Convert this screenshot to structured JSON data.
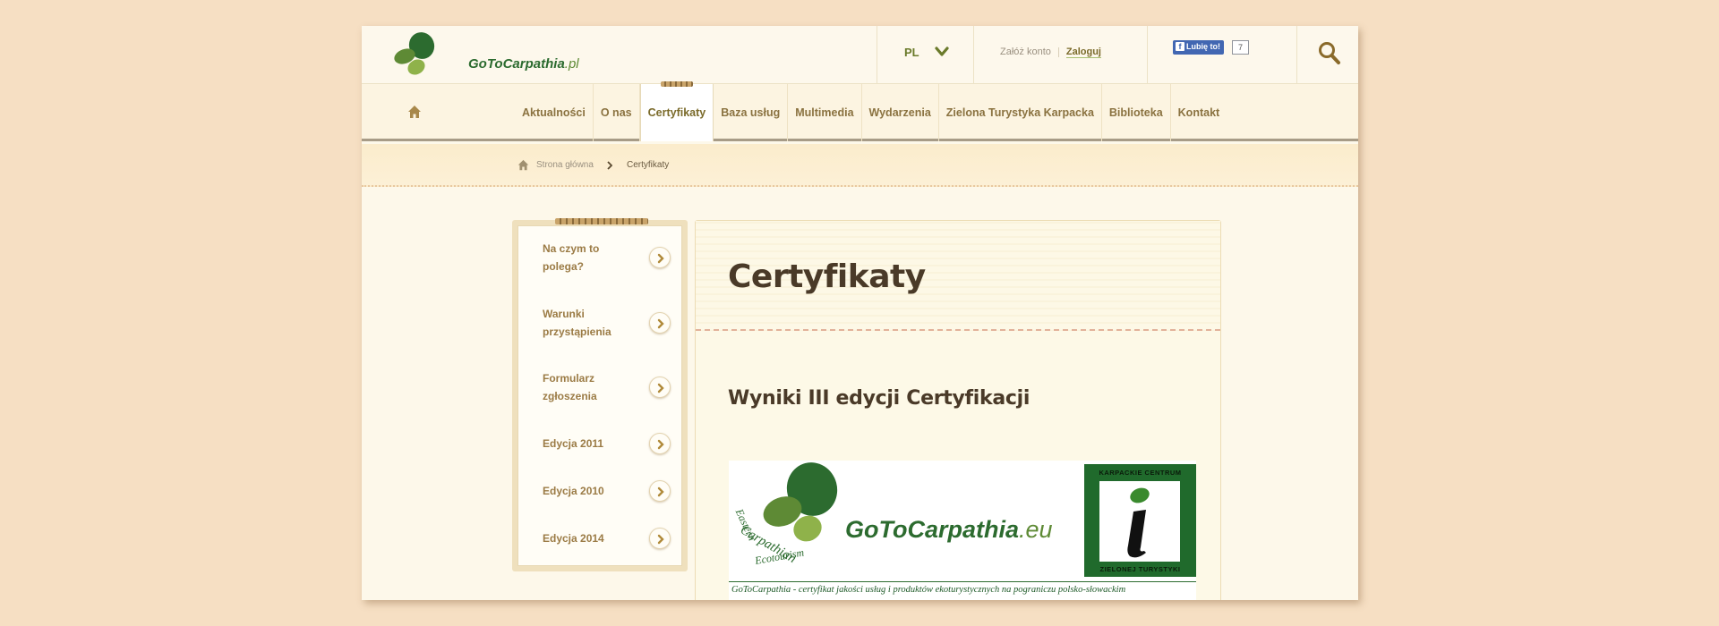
{
  "header": {
    "logo_text_brand": "GoToCarpathia",
    "logo_text_domain": ".pl",
    "language": "PL",
    "register_label": "Załóż konto",
    "login_label": "Zaloguj",
    "fb_like_label": "Lubię to!",
    "fb_count": "7"
  },
  "nav": {
    "items": [
      {
        "label": "Aktualności"
      },
      {
        "label": "O nas"
      },
      {
        "label": "Certyfikaty",
        "active": true
      },
      {
        "label": "Baza usług"
      },
      {
        "label": "Multimedia"
      },
      {
        "label": "Wydarzenia"
      },
      {
        "label": "Zielona Turystyka Karpacka"
      },
      {
        "label": "Biblioteka"
      },
      {
        "label": "Kontakt"
      }
    ]
  },
  "breadcrumb": {
    "home": "Strona główna",
    "current": "Certyfikaty"
  },
  "sidebar": {
    "items": [
      {
        "label": "Na czym to polega?"
      },
      {
        "label": "Warunki przystąpienia"
      },
      {
        "label": "Formularz zgłoszenia"
      },
      {
        "label": "Edycja 2011"
      },
      {
        "label": "Edycja 2010"
      },
      {
        "label": "Edycja 2014"
      }
    ]
  },
  "main": {
    "title": "Certyfikaty",
    "section_heading": "Wyniki III edycji Certyfikacji",
    "banner": {
      "brand": "GoToCarpathia",
      "brand_domain": ".eu",
      "eco_line1": "Eastern",
      "eco_line2": "Carpathian",
      "eco_line3": "Ecotourism",
      "kct_top": "KARPACKIE CENTRUM",
      "kct_bottom": "ZIELONEJ TURYSTYKI",
      "caption": "GoToCarpathia - certyfikat jakości usług i produktów ekoturystycznych na pograniczu polsko-słowackim"
    }
  },
  "colors": {
    "background": "#f6dfc3",
    "page": "#fdf8ea",
    "brand_dark_green": "#2c6b2f",
    "brand_light_green": "#6a9a3a",
    "nav_text": "#8a7240",
    "title_text": "#4a3a28"
  },
  "icons": {
    "logo": "leaf-cluster-logo",
    "language_dropdown": "chevron-down-icon",
    "search": "search-icon",
    "home": "home-icon",
    "breadcrumb_separator": "chevron-right-icon",
    "sidebar_item": "chevron-right-circle-icon"
  }
}
